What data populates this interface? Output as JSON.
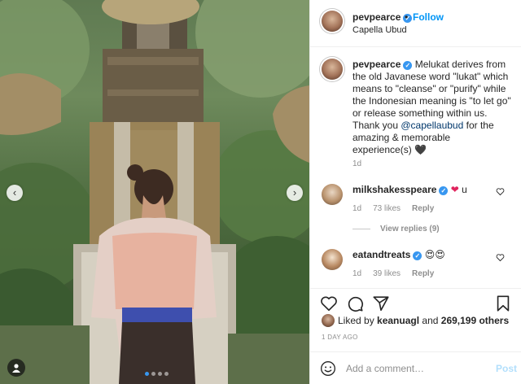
{
  "post": {
    "username": "pevpearce",
    "location": "Capella Ubud",
    "follow_label": "Follow",
    "separator": "•"
  },
  "caption": {
    "username": "pevpearce",
    "text_part1": " Melukat derives from the old Javanese word \"lukat\" which means to \"cleanse\" or \"purify\" while the Indonesian meaning is \"to let go\" or release something within us. Thank you ",
    "mention": "@capellaubud",
    "text_part2": " for the amazing & memorable experience(s) ",
    "emoji": "🖤",
    "age": "1d"
  },
  "comments": [
    {
      "username": "milkshakesspeare",
      "emoji": "❤",
      "text": " u",
      "age": "1d",
      "likes": "73 likes",
      "reply_label": "Reply",
      "view_replies": "View replies (9)"
    },
    {
      "username": "eatandtreats",
      "emoji": "😍😍",
      "text": "",
      "age": "1d",
      "likes": "39 likes",
      "reply_label": "Reply"
    }
  ],
  "likes": {
    "prefix": "Liked by ",
    "user": "keanuagl",
    "middle": " and ",
    "count": "269,199 others"
  },
  "timestamp": "1 DAY AGO",
  "add_comment": {
    "placeholder": "Add a comment…",
    "post_label": "Post"
  },
  "carousel": {
    "total": 4,
    "active_index": 0
  },
  "icons": {
    "heart": "heart-icon",
    "comment": "comment-icon",
    "share": "share-icon",
    "save": "bookmark-icon",
    "emoji": "smiley-icon",
    "prev": "chevron-left-icon",
    "next": "chevron-right-icon",
    "tag": "user-tag-icon"
  },
  "colors": {
    "link": "#0095f6",
    "verified": "#3897f0",
    "post_disabled": "#b2dffc"
  }
}
